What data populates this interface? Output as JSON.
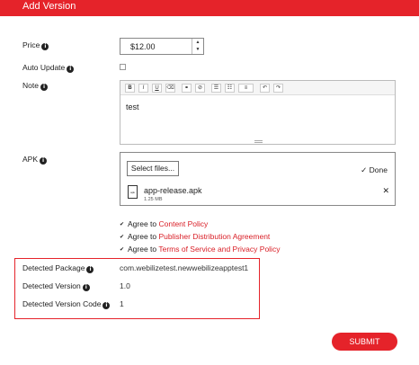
{
  "header": {
    "title": "Add Version"
  },
  "price": {
    "label": "Price",
    "value": "$12.00"
  },
  "auto_update": {
    "label": "Auto Update"
  },
  "note": {
    "label": "Note",
    "text": "test",
    "toolbar": [
      "B",
      "I",
      "U",
      "⌫",
      "⚭",
      "⊘",
      "☰",
      "☷",
      "≡",
      "↶",
      "↷"
    ]
  },
  "apk": {
    "label": "APK",
    "select_label": "Select files...",
    "done_label": "Done",
    "file_name": "app-release.apk",
    "file_size": "1.25 MB",
    "file_icon_text": "apk"
  },
  "agreements": [
    {
      "prefix": "Agree to ",
      "link": "Content Policy"
    },
    {
      "prefix": "Agree to ",
      "link": "Publisher Distribution Agreement"
    },
    {
      "prefix": "Agree to ",
      "link": "Terms of Service and Privacy Policy"
    }
  ],
  "detected": {
    "package_label": "Detected Package",
    "package_value": "com.webilizetest.newwebilizeapptest1",
    "version_label": "Detected Version",
    "version_value": "1.0",
    "code_label": "Detected Version Code",
    "code_value": "1"
  },
  "submit_label": "SUBMIT",
  "colors": {
    "accent": "#e5232a",
    "link": "#d91e26"
  }
}
